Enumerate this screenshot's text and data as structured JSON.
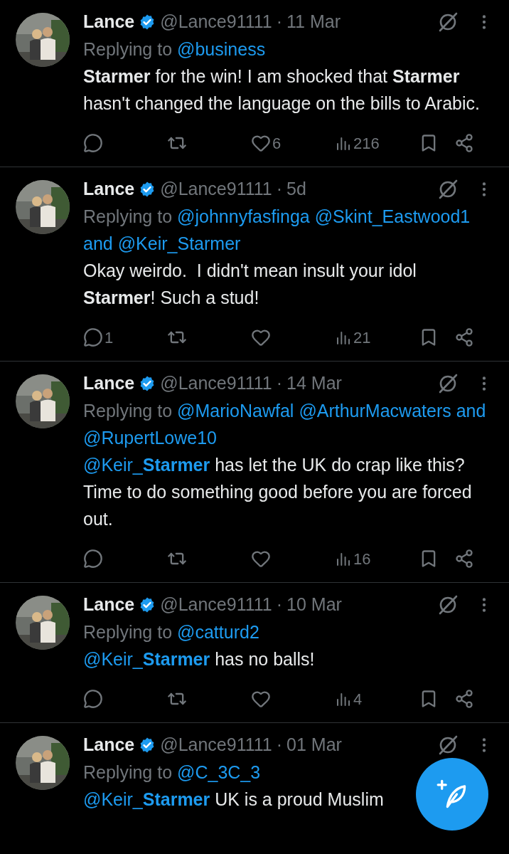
{
  "tweets": [
    {
      "name": "Lance",
      "handle": "@Lance91111",
      "dot": "·",
      "date": "11 Mar",
      "replying": {
        "label": "Replying to",
        "mentions": [
          "@business"
        ]
      },
      "body": [
        {
          "kind": "bold",
          "text": "Starmer"
        },
        {
          "kind": "text",
          "text": " for the win! I am shocked that "
        },
        {
          "kind": "bold",
          "text": "Starmer"
        },
        {
          "kind": "text",
          "text": " hasn't changed the language on the bills to Arabic."
        }
      ],
      "actions": [
        {
          "kind": "reply"
        },
        {
          "kind": "repost"
        },
        {
          "kind": "like",
          "count": "6"
        },
        {
          "kind": "views",
          "count": "216"
        },
        {
          "kind": "bookmark"
        },
        {
          "kind": "share"
        }
      ]
    },
    {
      "name": "Lance",
      "handle": "@Lance91111",
      "dot": "·",
      "date": "5d",
      "replying": {
        "label": "Replying to",
        "mentions": [
          "@johnnyfasfinga",
          "@Skint_Eastwood1",
          "@Keir_Starmer"
        ],
        "joiner": "and"
      },
      "body": [
        {
          "kind": "text",
          "text": "Okay weirdo.  I didn't mean insult your idol "
        },
        {
          "kind": "bold",
          "text": "Starmer"
        },
        {
          "kind": "text",
          "text": "! Such a stud!"
        }
      ],
      "actions": [
        {
          "kind": "reply",
          "count": "1"
        },
        {
          "kind": "repost"
        },
        {
          "kind": "like"
        },
        {
          "kind": "views",
          "count": "21"
        },
        {
          "kind": "bookmark"
        },
        {
          "kind": "share"
        }
      ]
    },
    {
      "name": "Lance",
      "handle": "@Lance91111",
      "dot": "·",
      "date": "14 Mar",
      "replying": {
        "label": "Replying to",
        "mentions": [
          "@MarioNawfal",
          "@ArthurMacwaters",
          "@RupertLowe10"
        ],
        "joiner": "and"
      },
      "body": [
        {
          "kind": "mention",
          "text": "@Keir_**Starmer**"
        },
        {
          "kind": "text",
          "text": " has let the UK do crap like this? Time to do something good before you are forced out."
        }
      ],
      "actions": [
        {
          "kind": "reply"
        },
        {
          "kind": "repost"
        },
        {
          "kind": "like"
        },
        {
          "kind": "views",
          "count": "16"
        },
        {
          "kind": "bookmark"
        },
        {
          "kind": "share"
        }
      ]
    },
    {
      "name": "Lance",
      "handle": "@Lance91111",
      "dot": "·",
      "date": "10 Mar",
      "replying": {
        "label": "Replying to",
        "mentions": [
          "@catturd2"
        ]
      },
      "body": [
        {
          "kind": "mention",
          "text": "@Keir_**Starmer**"
        },
        {
          "kind": "text",
          "text": " has no balls!"
        }
      ],
      "actions": [
        {
          "kind": "reply"
        },
        {
          "kind": "repost"
        },
        {
          "kind": "like"
        },
        {
          "kind": "views",
          "count": "4"
        },
        {
          "kind": "bookmark"
        },
        {
          "kind": "share"
        }
      ]
    },
    {
      "name": "Lance",
      "handle": "@Lance91111",
      "dot": "·",
      "date": "01 Mar",
      "replying": {
        "label": "Replying to",
        "mentions": [
          "@C_3C_3"
        ]
      },
      "body": [
        {
          "kind": "mention",
          "text": "@Keir_**Starmer**"
        },
        {
          "kind": "text",
          "text": " UK is a proud Muslim"
        }
      ]
    }
  ]
}
